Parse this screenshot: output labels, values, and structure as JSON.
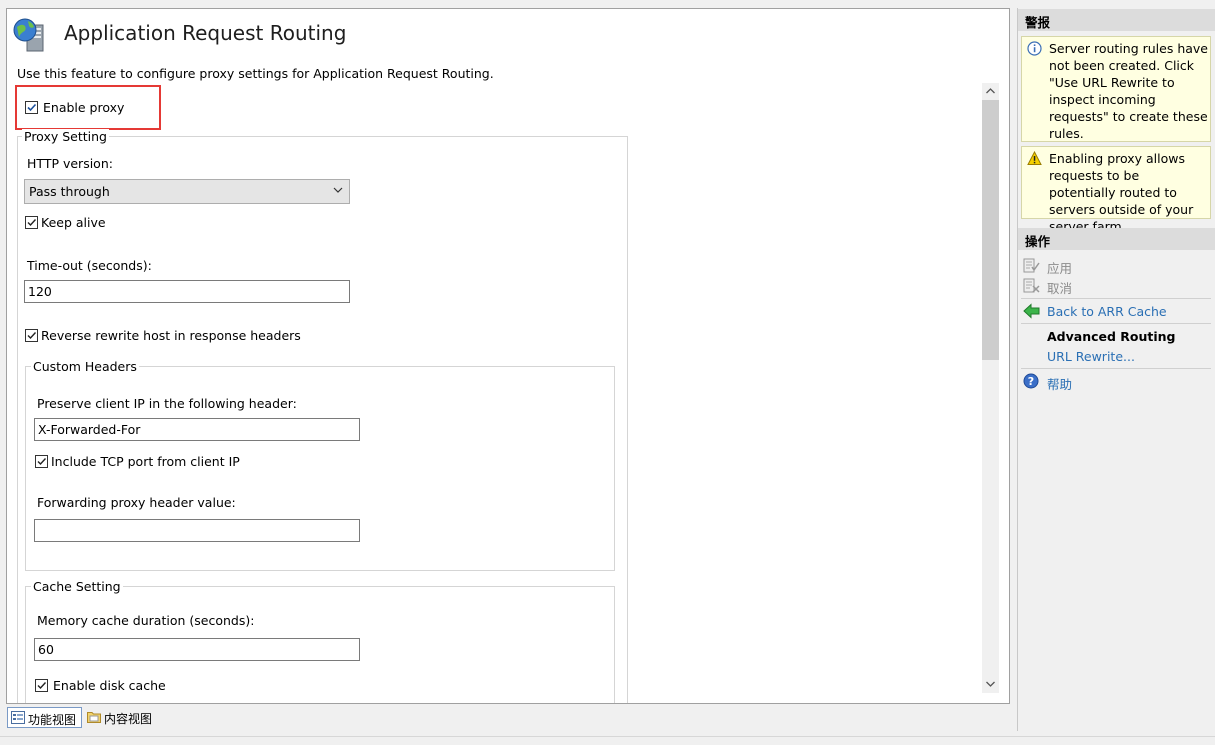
{
  "header": {
    "title": "Application Request Routing",
    "description": "Use this feature to configure proxy settings for Application Request Routing."
  },
  "enable_proxy": {
    "label": "Enable proxy",
    "checked": true
  },
  "proxy_setting": {
    "legend": "Proxy Setting",
    "http_version_label": "HTTP version:",
    "http_version_value": "Pass through",
    "keep_alive_label": "Keep alive",
    "timeout_label": "Time-out (seconds):",
    "timeout_value": "120",
    "reverse_rewrite_label": "Reverse rewrite host in response headers"
  },
  "custom_headers": {
    "legend": "Custom Headers",
    "preserve_ip_label": "Preserve client IP in the following header:",
    "preserve_ip_value": "X-Forwarded-For",
    "include_tcp_label": "Include TCP port from client IP",
    "forwarding_label": "Forwarding proxy header value:",
    "forwarding_value": ""
  },
  "cache_setting": {
    "legend": "Cache Setting",
    "memory_label": "Memory cache duration (seconds):",
    "memory_value": "60",
    "disk_cache_label": "Enable disk cache"
  },
  "tabs": {
    "features_view": "功能视图",
    "content_view": "内容视图"
  },
  "right_panel": {
    "alerts_header": "警报",
    "alert_info": "Server routing rules have not been created. Click \"Use URL Rewrite to inspect incoming requests\" to create these rules.",
    "alert_warning": "Enabling proxy allows requests to be potentially routed to servers outside of your server farm.",
    "actions_header": "操作",
    "apply": "应用",
    "cancel": "取消",
    "back_to_arr_cache": "Back to ARR Cache",
    "advanced_routing": "Advanced Routing",
    "url_rewrite": "URL Rewrite...",
    "help": "帮助"
  },
  "colors": {
    "link": "#2a6fb4",
    "highlight": "#e53935",
    "alert_bg": "#ffffe1"
  }
}
